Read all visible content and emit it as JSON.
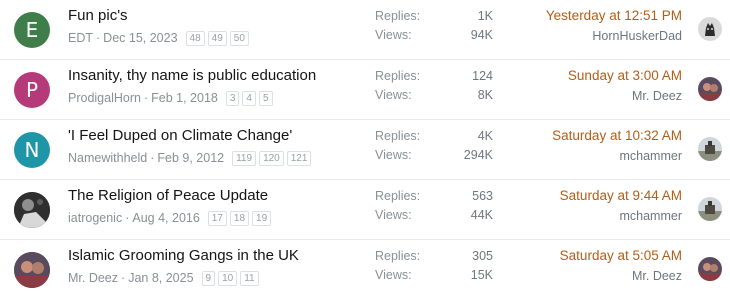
{
  "stat_labels": {
    "replies": "Replies:",
    "views": "Views:"
  },
  "threads": [
    {
      "title": "Fun pic's",
      "author": "EDT",
      "date": "Dec 15, 2023",
      "pages": [
        "48",
        "49",
        "50"
      ],
      "replies": "1K",
      "views": "94K",
      "last_date": "Yesterday at 12:51 PM",
      "last_user": "HornHuskerDad",
      "avatar_letter": "E",
      "avatar_color": "#3f7e4a"
    },
    {
      "title": "Insanity, thy name is public education",
      "author": "ProdigalHorn",
      "date": "Feb 1, 2018",
      "pages": [
        "3",
        "4",
        "5"
      ],
      "replies": "124",
      "views": "8K",
      "last_date": "Sunday at 3:00 AM",
      "last_user": "Mr. Deez",
      "avatar_letter": "P",
      "avatar_color": "#b43a7a"
    },
    {
      "title": "'I Feel Duped on Climate Change'",
      "author": "Namewithheld",
      "date": "Feb 9, 2012",
      "pages": [
        "119",
        "120",
        "121"
      ],
      "replies": "4K",
      "views": "294K",
      "last_date": "Saturday at 10:32 AM",
      "last_user": "mchammer",
      "avatar_letter": "N",
      "avatar_color": "#1f95a8"
    },
    {
      "title": "The Religion of Peace Update",
      "author": "iatrogenic",
      "date": "Aug 4, 2016",
      "pages": [
        "17",
        "18",
        "19"
      ],
      "replies": "563",
      "views": "44K",
      "last_date": "Saturday at 9:44 AM",
      "last_user": "mchammer"
    },
    {
      "title": "Islamic Grooming Gangs in the UK",
      "author": "Mr. Deez",
      "date": "Jan 8, 2025",
      "pages": [
        "9",
        "10",
        "11"
      ],
      "replies": "305",
      "views": "15K",
      "last_date": "Saturday at 5:05 AM",
      "last_user": "Mr. Deez"
    }
  ]
}
